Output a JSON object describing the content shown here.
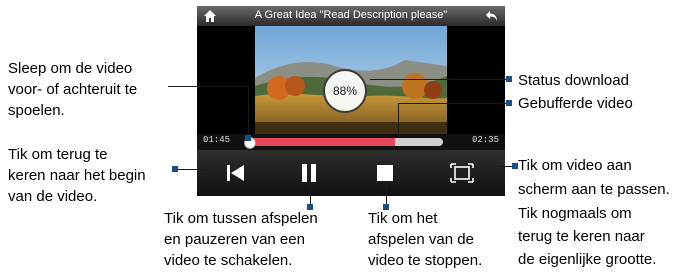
{
  "player": {
    "title": "A Great Idea \"Read Description please\"",
    "download_percent": "88%",
    "elapsed": "01:45",
    "total": "02:35",
    "playback_fraction": 0.02,
    "buffered_fraction": 0.76
  },
  "callouts": {
    "seek_1": "Sleep om de video",
    "seek_2": "voor- of achteruit te",
    "seek_3": "spoelen.",
    "status": "Status download",
    "buffered": "Gebufferde video",
    "restart_1": "Tik om terug te",
    "restart_2": "keren naar het begin",
    "restart_3": "van de video.",
    "fit_1": "Tik om video aan",
    "fit_2": "scherm aan te passen.",
    "fit_3": "Tik nogmaals om",
    "fit_4": "terug te keren naar",
    "fit_5": "de eigenlijke grootte.",
    "pause_1": "Tik om tussen afspelen",
    "pause_2": "en pauzeren van een",
    "pause_3": "video te schakelen.",
    "stop_1": "Tik om het",
    "stop_2": "afspelen van de",
    "stop_3": "video te stoppen."
  },
  "icons": {
    "home": "home-icon",
    "back": "back-arrow-icon",
    "restart": "skip-to-start-icon",
    "pause": "pause-icon",
    "stop": "stop-icon",
    "fit": "fit-screen-icon"
  },
  "colors": {
    "buffer_bar": "#e8475d",
    "callout_marker": "#1a4f86"
  }
}
